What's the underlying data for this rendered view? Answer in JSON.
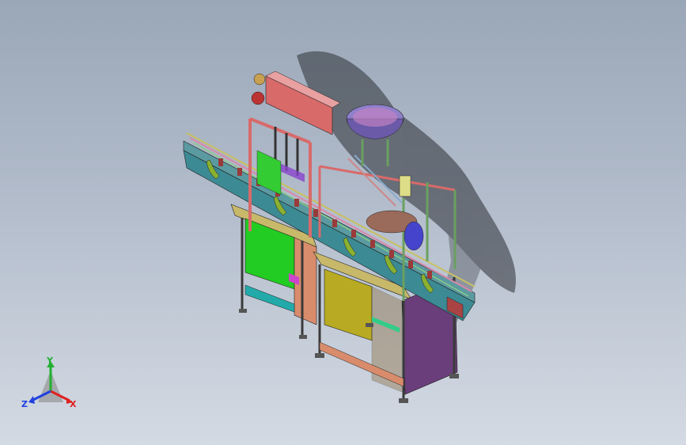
{
  "viewport": {
    "background_top": "#9aa7b7",
    "background_bottom": "#d4dae3"
  },
  "model": {
    "parts": [
      "frame-left",
      "frame-right",
      "conveyor",
      "filling-head",
      "vibratory-bowl-feeder",
      "capping-station",
      "shadow"
    ]
  },
  "triad": {
    "x_label": "X",
    "y_label": "Y",
    "z_label": "Z",
    "x_color": "#e02020",
    "y_color": "#20b030",
    "z_color": "#2040e0"
  }
}
